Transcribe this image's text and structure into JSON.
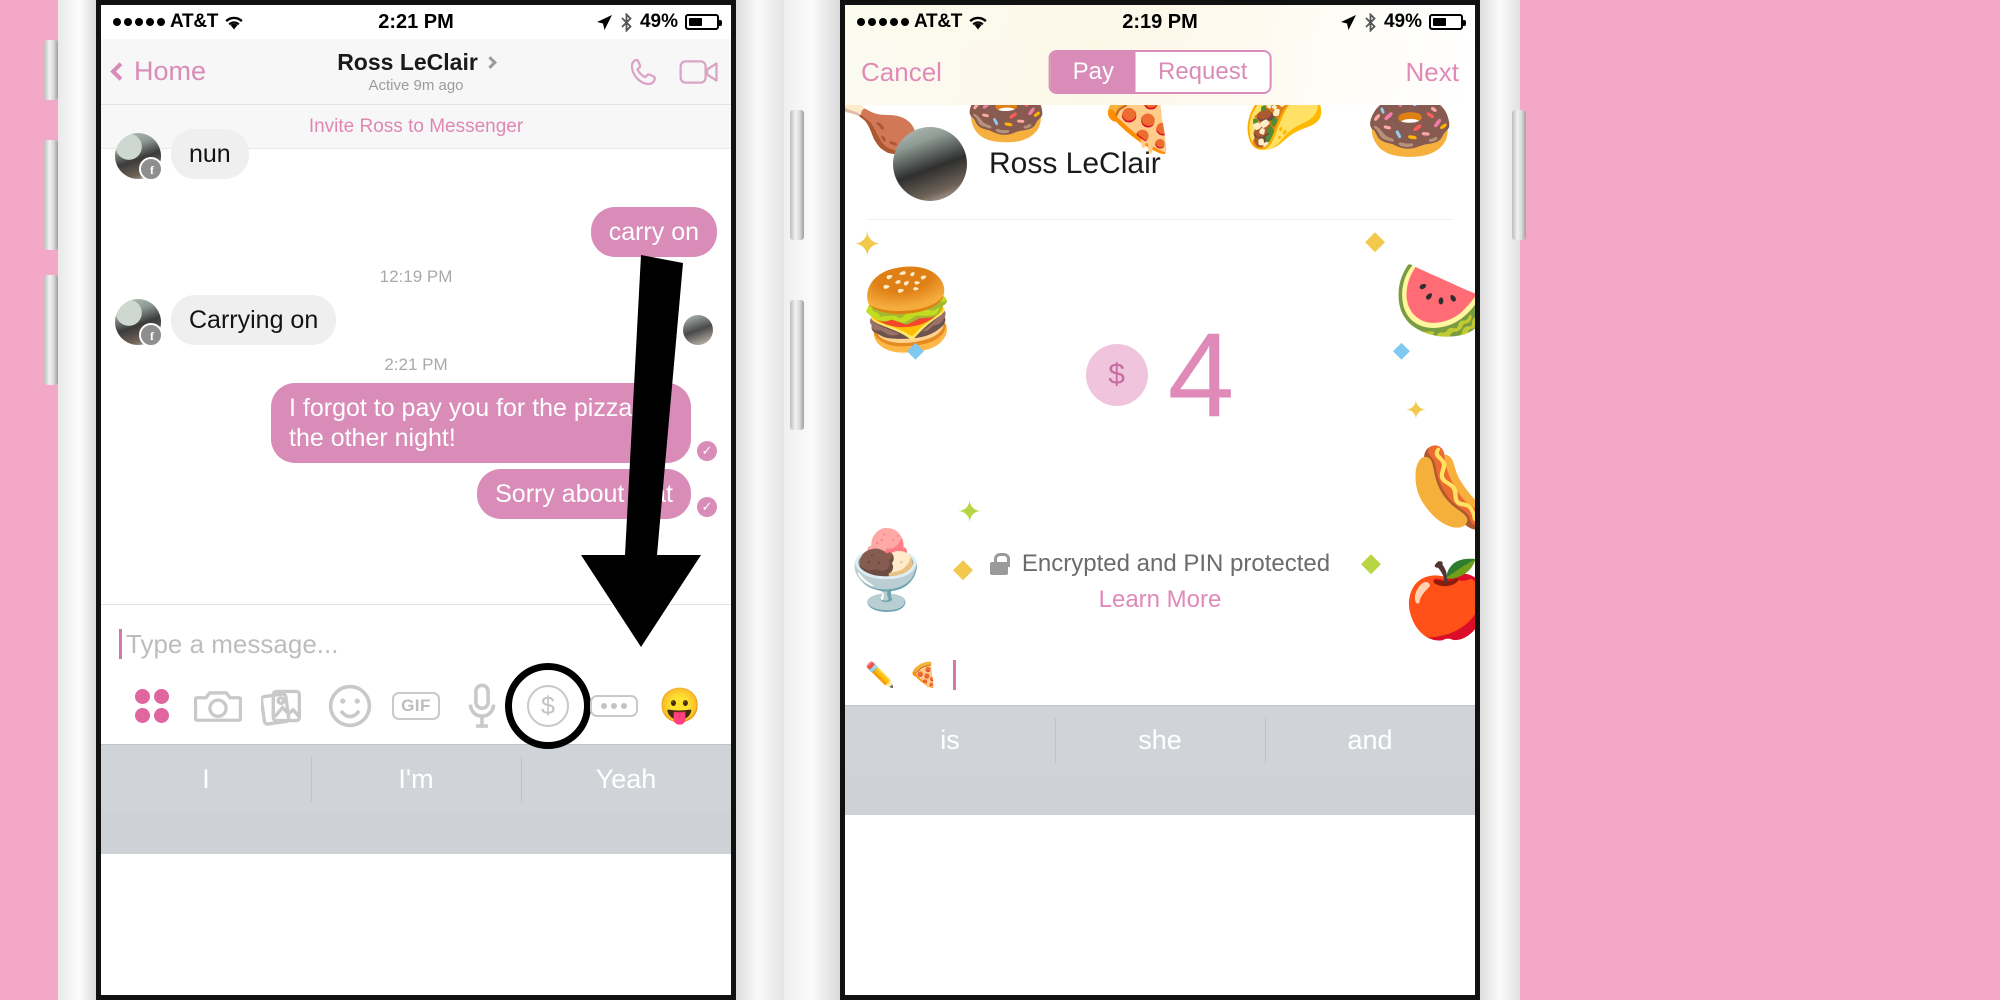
{
  "colors": {
    "backdrop": "#f3a8c8",
    "accent_pink": "#d98cb8",
    "link_pink": "#e08ab9",
    "bubble_in": "#efefef",
    "suggest_bar": "#d0d4d9"
  },
  "left_phone": {
    "status": {
      "carrier": "AT&T",
      "signal_dots": 5,
      "wifi": "wifi-icon",
      "time": "2:21 PM",
      "location": "location-arrow-icon",
      "bluetooth": "bluetooth-icon",
      "battery_percent": "49%",
      "battery_level": 49
    },
    "nav": {
      "back_label": "Home",
      "title": "Ross LeClair",
      "subtitle": "Active 9m ago",
      "call_icon": "phone-icon",
      "video_icon": "video-camera-icon"
    },
    "invite_banner": "Invite Ross to Messenger",
    "messages": [
      {
        "type": "incoming",
        "text": "nun",
        "avatar": true
      },
      {
        "type": "outgoing",
        "text": "carry on"
      },
      {
        "type": "timestamp",
        "text": "12:19 PM"
      },
      {
        "type": "incoming",
        "text": "Carrying on",
        "avatar": true
      },
      {
        "type": "timestamp",
        "text": "2:21 PM"
      },
      {
        "type": "outgoing",
        "text": "I forgot to pay you for the pizza the other night!",
        "seen": true
      },
      {
        "type": "outgoing",
        "text": "Sorry about that",
        "seen": true
      }
    ],
    "composer": {
      "placeholder": "Type a message...",
      "value": "",
      "tools": [
        {
          "name": "more-apps-grid-icon",
          "label": ""
        },
        {
          "name": "camera-icon",
          "label": ""
        },
        {
          "name": "photos-icon",
          "label": ""
        },
        {
          "name": "sticker-smiley-icon",
          "label": ""
        },
        {
          "name": "gif-icon",
          "label": "GIF"
        },
        {
          "name": "microphone-icon",
          "label": ""
        },
        {
          "name": "payment-dollar-icon",
          "label": "$",
          "highlighted": true
        },
        {
          "name": "more-options-icon",
          "label": ""
        },
        {
          "name": "emoji-icon",
          "label": "😛"
        }
      ]
    },
    "keyboard_suggestions": [
      "I",
      "I'm",
      "Yeah"
    ],
    "annotation": {
      "type": "arrow-down",
      "points_to": "payment-dollar-icon"
    }
  },
  "right_phone": {
    "status": {
      "carrier": "AT&T",
      "signal_dots": 5,
      "wifi": "wifi-icon",
      "time": "2:19 PM",
      "location": "location-arrow-icon",
      "bluetooth": "bluetooth-icon",
      "battery_percent": "49%",
      "battery_level": 49
    },
    "nav": {
      "cancel_label": "Cancel",
      "next_label": "Next",
      "segment": {
        "options": [
          "Pay",
          "Request"
        ],
        "selected": "Pay"
      }
    },
    "recipient": "Ross LeClair",
    "amount": {
      "currency_symbol": "$",
      "value": "4"
    },
    "security": {
      "lock_icon": "lock-icon",
      "text": "Encrypted and PIN protected",
      "link": "Learn More"
    },
    "note_composer": {
      "icons": [
        "pencil-icon",
        "pizza-emoji"
      ],
      "value": ""
    },
    "keyboard_suggestions": [
      "is",
      "she",
      "and"
    ]
  }
}
